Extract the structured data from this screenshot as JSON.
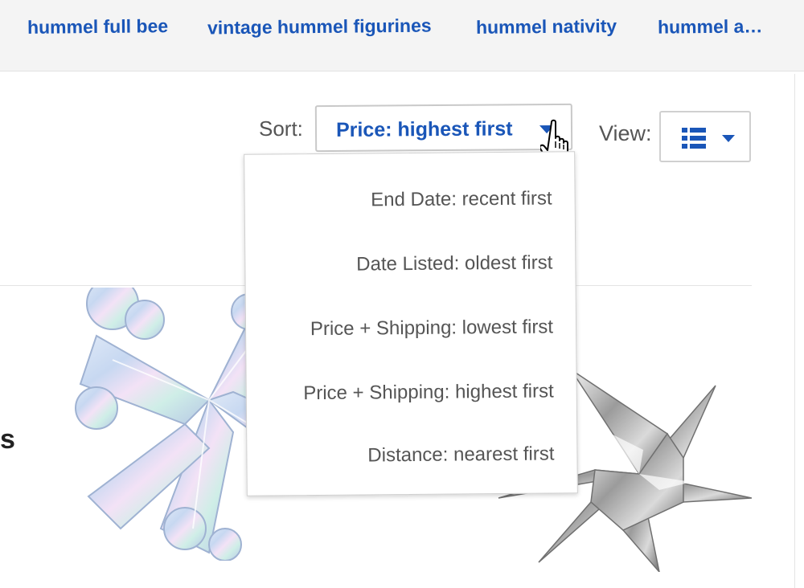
{
  "related_searches": [
    {
      "label": "hummel full bee"
    },
    {
      "label": "vintage hummel figurines"
    },
    {
      "label": "hummel nativity"
    },
    {
      "label": "hummel a…"
    }
  ],
  "sort": {
    "label": "Sort:",
    "selected": "Price: highest first",
    "options": [
      "End Date: recent first",
      "Date Listed: oldest first",
      "Price + Shipping: lowest first",
      "Price + Shipping: highest first",
      "Distance: nearest first"
    ]
  },
  "view": {
    "label": "View:",
    "icon": "list-view-icon"
  },
  "colors": {
    "link": "#1a56b8",
    "text": "#555555",
    "border": "#cfcfcf"
  },
  "result": {
    "partial_title_char": "s"
  }
}
